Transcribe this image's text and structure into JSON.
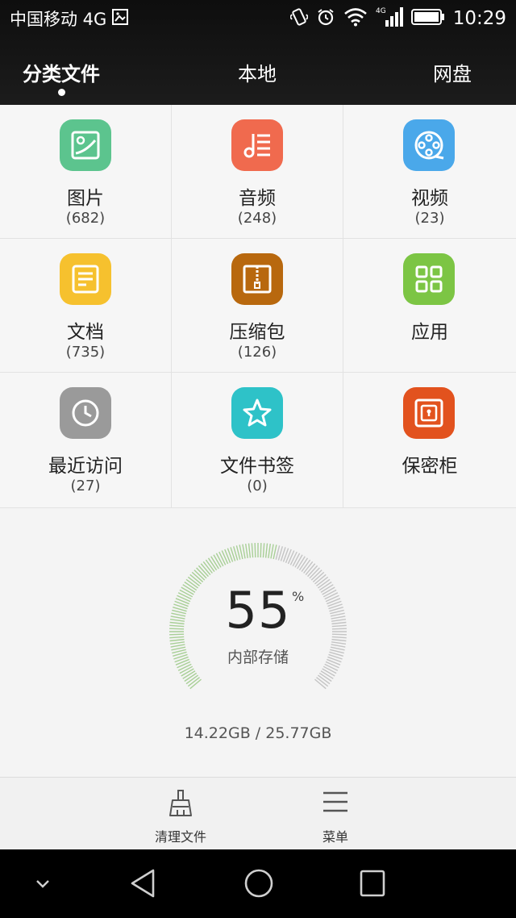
{
  "status_bar": {
    "carrier": "中国移动 4G",
    "time": "10:29",
    "icons": [
      "image-notification-icon",
      "vibrate-icon",
      "alarm-icon",
      "wifi-icon",
      "signal-4g-icon",
      "battery-icon"
    ]
  },
  "tabs": [
    {
      "label": "分类文件",
      "active": true
    },
    {
      "label": "本地",
      "active": false
    },
    {
      "label": "网盘",
      "active": false
    }
  ],
  "categories": [
    {
      "label": "图片",
      "count": "(682)",
      "icon": "image-icon",
      "color": "#5cc48e"
    },
    {
      "label": "音频",
      "count": "(248)",
      "icon": "music-icon",
      "color": "#f06a4e"
    },
    {
      "label": "视频",
      "count": "(23)",
      "icon": "film-icon",
      "color": "#4aa8ea"
    },
    {
      "label": "文档",
      "count": "(735)",
      "icon": "document-icon",
      "color": "#f6c12e"
    },
    {
      "label": "压缩包",
      "count": "(126)",
      "icon": "zip-icon",
      "color": "#b8680e"
    },
    {
      "label": "应用",
      "count": "",
      "icon": "apps-grid-icon",
      "color": "#7cc544"
    },
    {
      "label": "最近访问",
      "count": "(27)",
      "icon": "clock-icon",
      "color": "#9a9a9a"
    },
    {
      "label": "文件书签",
      "count": "(0)",
      "icon": "star-icon",
      "color": "#2ec2c8"
    },
    {
      "label": "保密柜",
      "count": "",
      "icon": "safe-icon",
      "color": "#e2521e"
    }
  ],
  "storage": {
    "percent": "55",
    "percent_sign": "%",
    "used_fraction": 0.55,
    "label": "内部存储",
    "size": "14.22GB / 25.77GB",
    "used_color": "#a8cf96",
    "free_color": "#c4c4c4"
  },
  "toolbar": {
    "clean_label": "清理文件",
    "menu_label": "菜单"
  },
  "nav": [
    "collapse-icon",
    "back-icon",
    "home-icon",
    "recents-icon"
  ]
}
